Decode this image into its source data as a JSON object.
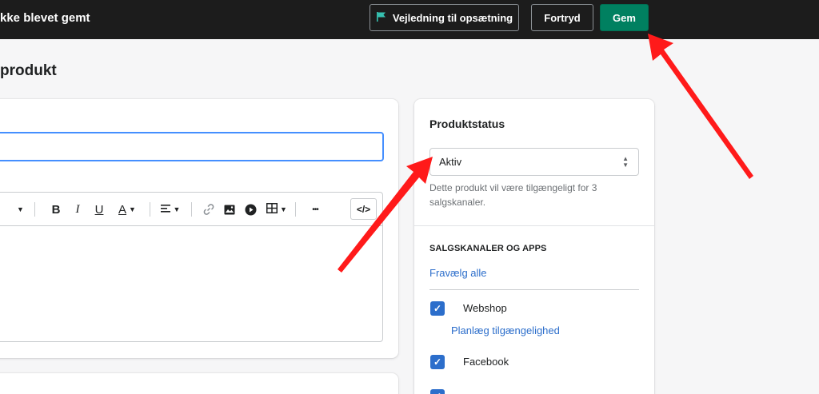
{
  "topbar": {
    "title": "kke blevet gemt",
    "guide_label": "Vejledning til opsætning",
    "undo_label": "Fortryd",
    "save_label": "Gem"
  },
  "page": {
    "title": "produkt"
  },
  "editor": {
    "toolbar": {
      "bold": "B",
      "italic": "I",
      "underline": "U",
      "text_color": "A",
      "more": "•••",
      "code": "</>"
    }
  },
  "sidebar": {
    "status_heading": "Produktstatus",
    "status_value": "Aktiv",
    "status_help": "Dette produkt vil være tilgængeligt for 3 salgskanaler.",
    "channels_heading": "SALGSKANALER OG APPS",
    "deselect_all": "Fravælg alle",
    "channels": [
      {
        "label": "Webshop",
        "checked": true,
        "schedule_link": "Planlæg tilgængelighed"
      },
      {
        "label": "Facebook",
        "checked": true
      }
    ]
  },
  "colors": {
    "topbar_bg": "#1c1c1c",
    "save_button": "#008060",
    "link": "#2c6ecb",
    "checkbox": "#2c6ecb",
    "annotation_arrow": "#ff1a1a"
  }
}
